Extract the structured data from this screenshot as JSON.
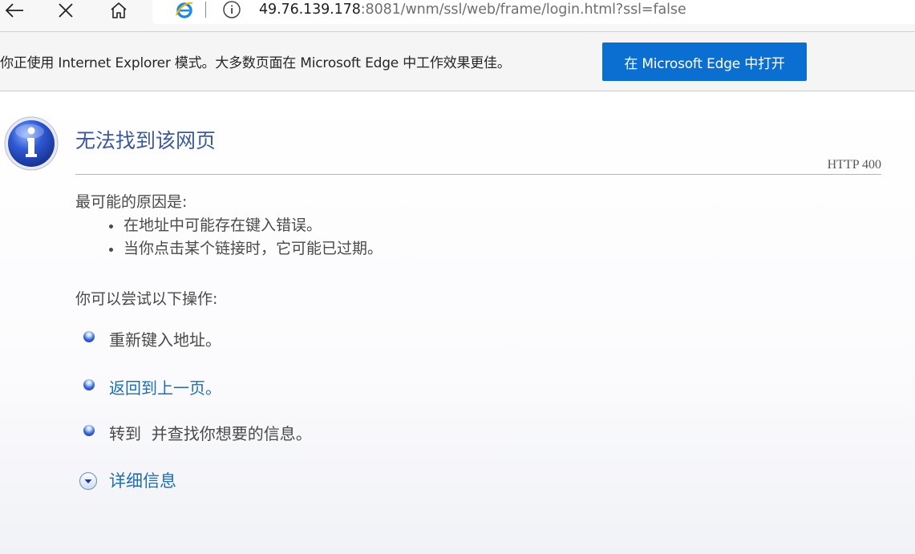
{
  "toolbar": {
    "back_icon": "back-arrow-icon",
    "close_icon": "close-icon",
    "home_icon": "home-icon"
  },
  "address_bar": {
    "url_host": "49.76.139.178",
    "url_rest": ":8081/wnm/ssl/web/frame/login.html?ssl=false",
    "ie_icon": "internet-explorer-icon",
    "info_icon": "info-icon"
  },
  "banner": {
    "message": "你正使用 Internet Explorer 模式。大多数页面在 Microsoft Edge 中工作效果更佳。",
    "button_label": "在 Microsoft Edge 中打开",
    "button_color": "#0a6fd1"
  },
  "error_page": {
    "title": "无法找到该网页",
    "http_code": "HTTP 400",
    "reasons_label": "最可能的原因是:",
    "reasons": [
      "在地址中可能存在键入错误。",
      "当你点击某个链接时，它可能已过期。"
    ],
    "actions_label": "你可以尝试以下操作:",
    "actions": [
      {
        "text": "重新键入地址。",
        "is_link": false
      },
      {
        "text": "返回到上一页。",
        "is_link": true
      },
      {
        "text": "转到  并查找你想要的信息。",
        "is_link": false
      }
    ],
    "details_label": "详细信息",
    "title_color": "#3c5a9a",
    "link_color": "#1f6fad"
  }
}
